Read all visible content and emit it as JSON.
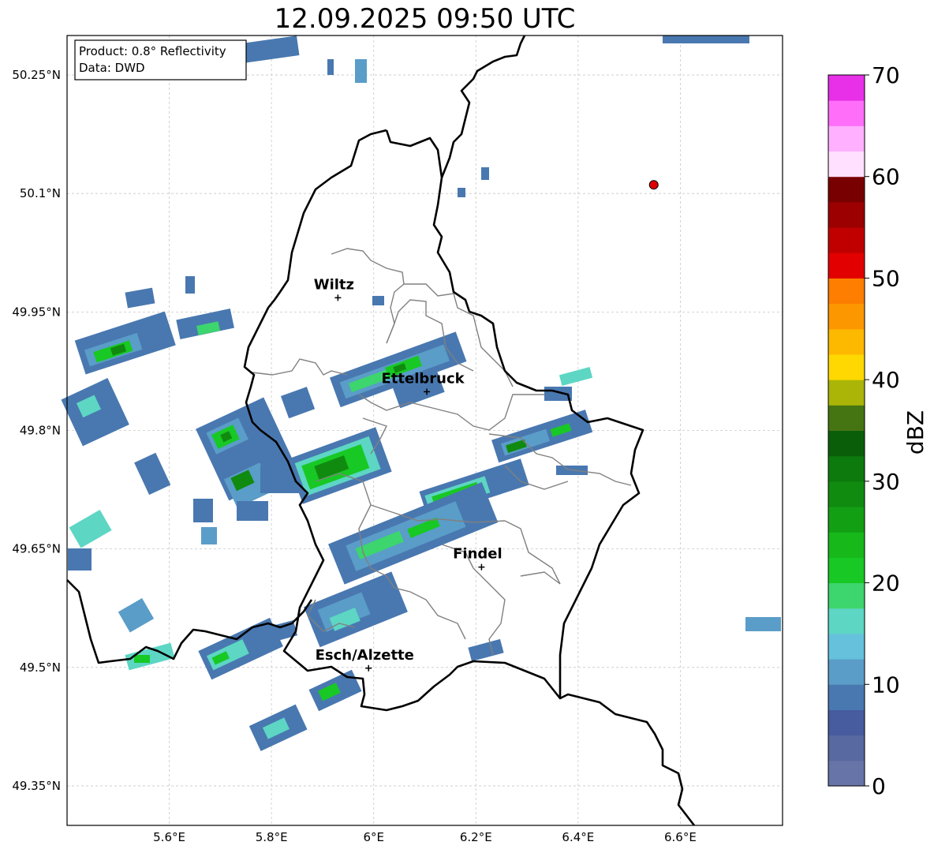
{
  "title": "12.09.2025 09:50 UTC",
  "info": {
    "product": "Product: 0.8° Reflectivity",
    "data": "Data: DWD"
  },
  "map": {
    "lon_range": [
      5.4,
      6.8
    ],
    "lat_range": [
      49.3,
      50.3
    ],
    "lon_ticks": [
      5.6,
      5.8,
      6.0,
      6.2,
      6.4,
      6.6
    ],
    "lon_tick_labels": [
      "5.6°E",
      "5.8°E",
      "6°E",
      "6.2°E",
      "6.4°E",
      "6.6°E"
    ],
    "lat_ticks": [
      50.25,
      50.1,
      49.95,
      49.8,
      49.65,
      49.5,
      49.35
    ],
    "lat_tick_labels": [
      "50.25°N",
      "50.1°N",
      "49.95°N",
      "49.8°N",
      "49.65°N",
      "49.5°N",
      "49.35°N"
    ],
    "grid": true,
    "cities": [
      {
        "name": "Wiltz",
        "lon": 5.93,
        "lat": 49.968
      },
      {
        "name": "Ettelbruck",
        "lon": 6.104,
        "lat": 49.849
      },
      {
        "name": "Findel",
        "lon": 6.211,
        "lat": 49.627
      },
      {
        "name": "Esch/Alzette",
        "lon": 5.99,
        "lat": 49.499
      }
    ],
    "radar_site": {
      "lon": 6.548,
      "lat": 50.111,
      "color": "#e00000"
    }
  },
  "colorbar": {
    "label": "dBZ",
    "min": 0,
    "max": 70,
    "step": 2.5,
    "ticks": [
      0,
      10,
      20,
      30,
      40,
      50,
      60,
      70
    ],
    "tick_labels": [
      "0",
      "10",
      "20",
      "30",
      "40",
      "50",
      "60",
      "70"
    ],
    "colors": [
      "#6774a8",
      "#5868a0",
      "#465c9e",
      "#4978b0",
      "#5a9dc8",
      "#65c1dc",
      "#5dd6c4",
      "#3dd56e",
      "#18c824",
      "#16b81a",
      "#139f14",
      "#108b10",
      "#0d7a0d",
      "#0a5e0a",
      "#457512",
      "#aab508",
      "#fed800",
      "#fdb800",
      "#fd9700",
      "#fd7e00",
      "#e20000",
      "#c00000",
      "#9c0000",
      "#780000",
      "#ffe0ff",
      "#ffb0ff",
      "#ff6ef9",
      "#e830e8"
    ]
  }
}
